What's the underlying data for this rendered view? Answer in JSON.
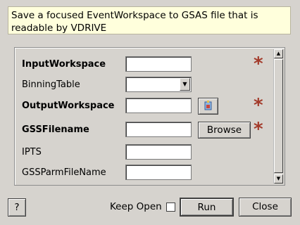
{
  "description": "Save a focused EventWorkspace to GSAS file that is readable by VDRIVE",
  "fields": [
    {
      "label": "InputWorkspace",
      "value": "",
      "required": true
    },
    {
      "label": "BinningTable",
      "value": "",
      "required": false
    },
    {
      "label": "OutputWorkspace",
      "value": "",
      "required": true
    },
    {
      "label": "GSSFilename",
      "value": "",
      "required": true
    },
    {
      "label": "IPTS",
      "value": "",
      "required": false
    },
    {
      "label": "GSSParmFileName",
      "value": "",
      "required": false
    }
  ],
  "required_marker": "*",
  "browse_label": "Browse",
  "help_label": "?",
  "keep_open_label": "Keep Open",
  "keep_open_checked": false,
  "run_label": "Run",
  "close_label": "Close",
  "colors": {
    "required_star": "#a33a2a",
    "description_bg": "#ffffdc",
    "window_bg": "#d6d3ce"
  }
}
